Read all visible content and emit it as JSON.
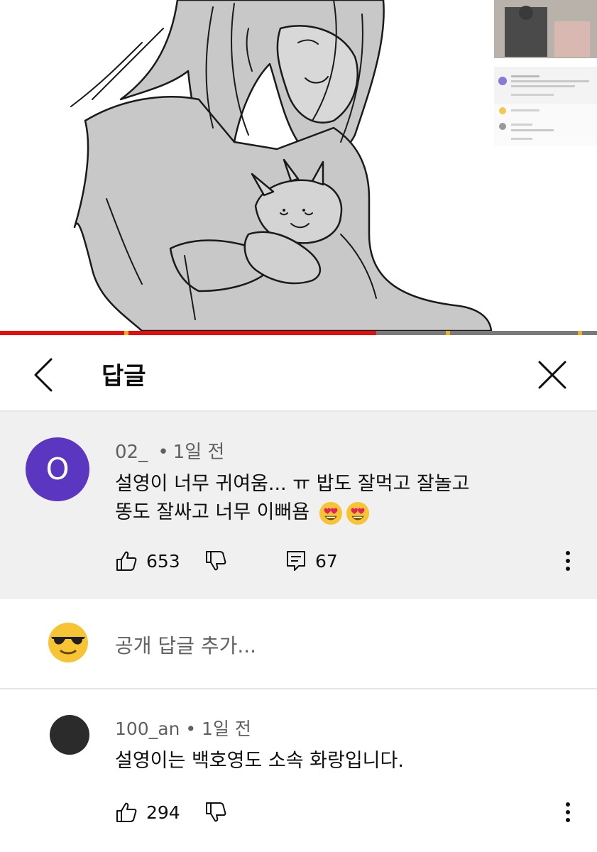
{
  "header": {
    "title": "답글"
  },
  "main_comment": {
    "avatar_letter": "O",
    "avatar_color": "#5b36c0",
    "author": "02_",
    "time": "1일 전",
    "text_line1": "설영이 너무 귀여움... ㅠ 밥도 잘먹고 잘놀고",
    "text_line2": "똥도 잘싸고 너무 이뻐욤",
    "emojis": [
      "heart-eyes",
      "heart-eyes"
    ],
    "like_count": "653",
    "reply_count": "67"
  },
  "add_reply": {
    "placeholder": "공개 답글 추가..."
  },
  "reply": {
    "author": "100_an",
    "time": "1일 전",
    "text": "설영이는 백호영도 소속 화랑입니다.",
    "like_count": "294"
  },
  "progress": {
    "played_fraction": 0.63,
    "accent_color": "#e01010"
  }
}
